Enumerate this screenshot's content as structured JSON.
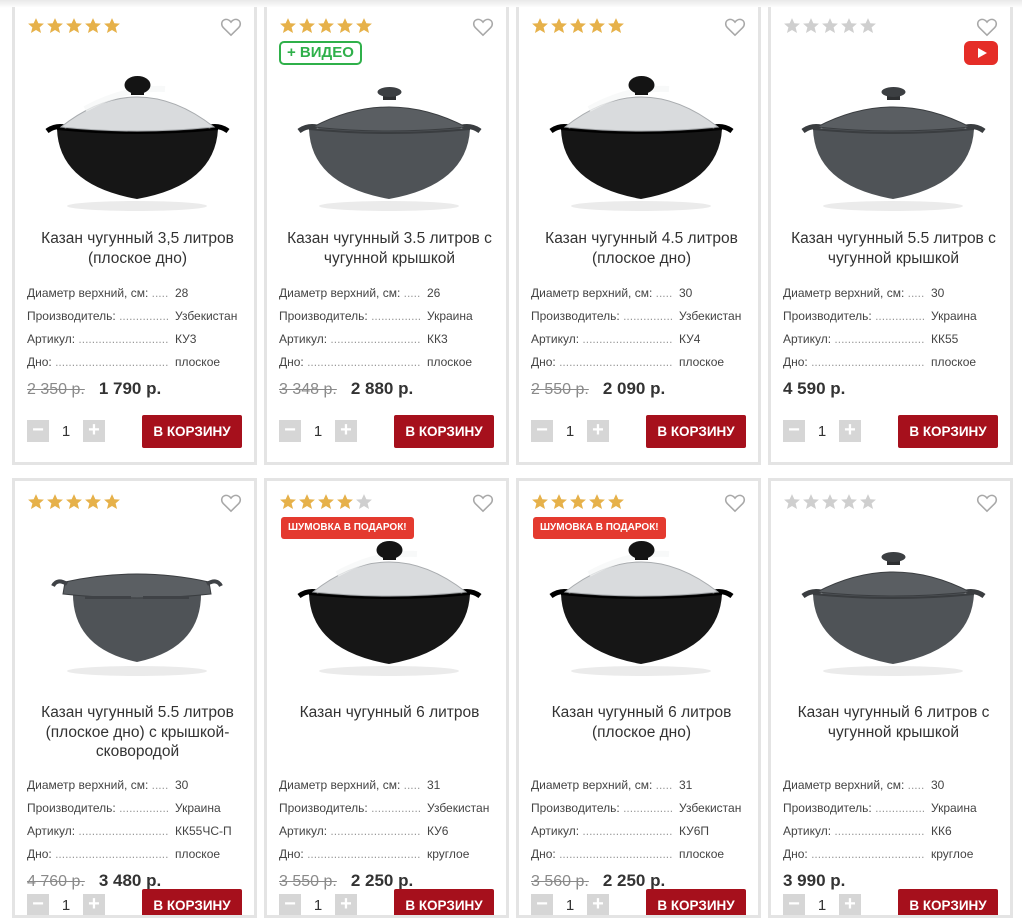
{
  "colors": {
    "accent": "#a6101c",
    "star_gold": "#e6b14a",
    "star_grey": "#cfcfcf",
    "video_green": "#2fb04a",
    "gift_red": "#e43a2f"
  },
  "icons": {
    "favorite": "heart-outline-icon",
    "rating": "star-icon",
    "video": "youtube-play-icon",
    "minus": "minus-icon",
    "plus": "plus-icon"
  },
  "labels": {
    "diameter": "Диаметр верхний, см:",
    "maker": "Производитель:",
    "article": "Артикул:",
    "bottom": "Дно:",
    "cart": "В КОРЗИНУ",
    "video_badge": "+ ВИДЕО",
    "gift_badge": "ШУМОВКА В ПОДАРОК!"
  },
  "products": [
    {
      "rating": 5,
      "title": "Казан чугунный 3,5 литров (плоское дно)",
      "diameter": "28",
      "maker": "Узбекистан",
      "article": "КУ3",
      "bottom": "плоское",
      "old_price": "2 350 р.",
      "price": "1 790 р.",
      "qty": "1",
      "lid": "aluminum",
      "badge": ""
    },
    {
      "rating": 5,
      "title": "Казан чугунный 3.5 литров с чугунной крышкой",
      "diameter": "26",
      "maker": "Украина",
      "article": "КК3",
      "bottom": "плоское",
      "old_price": "3 348 р.",
      "price": "2 880 р.",
      "qty": "1",
      "lid": "castiron",
      "badge": "video"
    },
    {
      "rating": 5,
      "title": "Казан чугунный 4.5 литров (плоское дно)",
      "diameter": "30",
      "maker": "Узбекистан",
      "article": "КУ4",
      "bottom": "плоское",
      "old_price": "2 550 р.",
      "price": "2 090 р.",
      "qty": "1",
      "lid": "aluminum",
      "badge": ""
    },
    {
      "rating": 0,
      "title": "Казан чугунный 5.5 литров с чугунной крышкой",
      "diameter": "30",
      "maker": "Украина",
      "article": "КК55",
      "bottom": "плоское",
      "old_price": "",
      "price": "4 590 р.",
      "qty": "1",
      "lid": "castiron",
      "badge": "youtube"
    },
    {
      "rating": 5,
      "title": "Казан чугунный 5.5 литров (плоское дно) с крышкой-сковородой",
      "diameter": "30",
      "maker": "Украина",
      "article": "КК55ЧС-П",
      "bottom": "плоское",
      "old_price": "4 760 р.",
      "price": "3 480 р.",
      "qty": "1",
      "lid": "pan",
      "badge": ""
    },
    {
      "rating": 4,
      "title": "Казан чугунный 6 литров",
      "diameter": "31",
      "maker": "Узбекистан",
      "article": "КУ6",
      "bottom": "круглое",
      "old_price": "3 550 р.",
      "price": "2 250 р.",
      "qty": "1",
      "lid": "aluminum",
      "badge": "gift"
    },
    {
      "rating": 5,
      "title": "Казан чугунный 6 литров (плоское дно)",
      "diameter": "31",
      "maker": "Узбекистан",
      "article": "КУ6П",
      "bottom": "плоское",
      "old_price": "3 560 р.",
      "price": "2 250 р.",
      "qty": "1",
      "lid": "aluminum",
      "badge": "gift"
    },
    {
      "rating": 0,
      "title": "Казан чугунный 6 литров с чугунной крышкой",
      "diameter": "30",
      "maker": "Украина",
      "article": "КК6",
      "bottom": "круглое",
      "old_price": "",
      "price": "3 990 р.",
      "qty": "1",
      "lid": "castiron",
      "badge": ""
    }
  ]
}
